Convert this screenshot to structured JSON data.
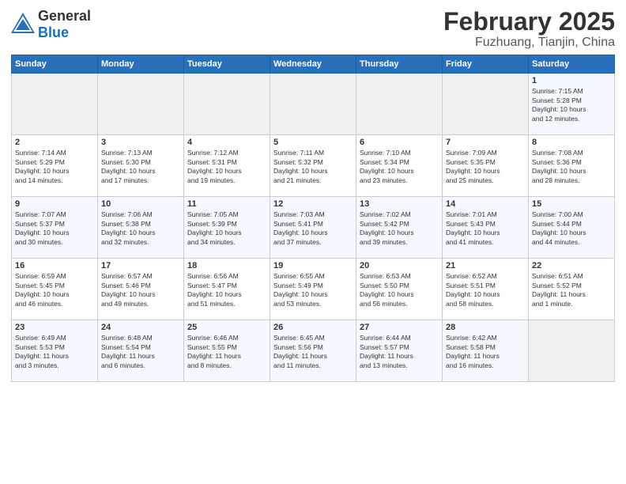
{
  "header": {
    "logo_general": "General",
    "logo_blue": "Blue",
    "month_title": "February 2025",
    "location": "Fuzhuang, Tianjin, China"
  },
  "days_of_week": [
    "Sunday",
    "Monday",
    "Tuesday",
    "Wednesday",
    "Thursday",
    "Friday",
    "Saturday"
  ],
  "weeks": [
    [
      {
        "day": "",
        "info": ""
      },
      {
        "day": "",
        "info": ""
      },
      {
        "day": "",
        "info": ""
      },
      {
        "day": "",
        "info": ""
      },
      {
        "day": "",
        "info": ""
      },
      {
        "day": "",
        "info": ""
      },
      {
        "day": "1",
        "info": "Sunrise: 7:15 AM\nSunset: 5:28 PM\nDaylight: 10 hours\nand 12 minutes."
      }
    ],
    [
      {
        "day": "2",
        "info": "Sunrise: 7:14 AM\nSunset: 5:29 PM\nDaylight: 10 hours\nand 14 minutes."
      },
      {
        "day": "3",
        "info": "Sunrise: 7:13 AM\nSunset: 5:30 PM\nDaylight: 10 hours\nand 17 minutes."
      },
      {
        "day": "4",
        "info": "Sunrise: 7:12 AM\nSunset: 5:31 PM\nDaylight: 10 hours\nand 19 minutes."
      },
      {
        "day": "5",
        "info": "Sunrise: 7:11 AM\nSunset: 5:32 PM\nDaylight: 10 hours\nand 21 minutes."
      },
      {
        "day": "6",
        "info": "Sunrise: 7:10 AM\nSunset: 5:34 PM\nDaylight: 10 hours\nand 23 minutes."
      },
      {
        "day": "7",
        "info": "Sunrise: 7:09 AM\nSunset: 5:35 PM\nDaylight: 10 hours\nand 25 minutes."
      },
      {
        "day": "8",
        "info": "Sunrise: 7:08 AM\nSunset: 5:36 PM\nDaylight: 10 hours\nand 28 minutes."
      }
    ],
    [
      {
        "day": "9",
        "info": "Sunrise: 7:07 AM\nSunset: 5:37 PM\nDaylight: 10 hours\nand 30 minutes."
      },
      {
        "day": "10",
        "info": "Sunrise: 7:06 AM\nSunset: 5:38 PM\nDaylight: 10 hours\nand 32 minutes."
      },
      {
        "day": "11",
        "info": "Sunrise: 7:05 AM\nSunset: 5:39 PM\nDaylight: 10 hours\nand 34 minutes."
      },
      {
        "day": "12",
        "info": "Sunrise: 7:03 AM\nSunset: 5:41 PM\nDaylight: 10 hours\nand 37 minutes."
      },
      {
        "day": "13",
        "info": "Sunrise: 7:02 AM\nSunset: 5:42 PM\nDaylight: 10 hours\nand 39 minutes."
      },
      {
        "day": "14",
        "info": "Sunrise: 7:01 AM\nSunset: 5:43 PM\nDaylight: 10 hours\nand 41 minutes."
      },
      {
        "day": "15",
        "info": "Sunrise: 7:00 AM\nSunset: 5:44 PM\nDaylight: 10 hours\nand 44 minutes."
      }
    ],
    [
      {
        "day": "16",
        "info": "Sunrise: 6:59 AM\nSunset: 5:45 PM\nDaylight: 10 hours\nand 46 minutes."
      },
      {
        "day": "17",
        "info": "Sunrise: 6:57 AM\nSunset: 5:46 PM\nDaylight: 10 hours\nand 49 minutes."
      },
      {
        "day": "18",
        "info": "Sunrise: 6:56 AM\nSunset: 5:47 PM\nDaylight: 10 hours\nand 51 minutes."
      },
      {
        "day": "19",
        "info": "Sunrise: 6:55 AM\nSunset: 5:49 PM\nDaylight: 10 hours\nand 53 minutes."
      },
      {
        "day": "20",
        "info": "Sunrise: 6:53 AM\nSunset: 5:50 PM\nDaylight: 10 hours\nand 56 minutes."
      },
      {
        "day": "21",
        "info": "Sunrise: 6:52 AM\nSunset: 5:51 PM\nDaylight: 10 hours\nand 58 minutes."
      },
      {
        "day": "22",
        "info": "Sunrise: 6:51 AM\nSunset: 5:52 PM\nDaylight: 11 hours\nand 1 minute."
      }
    ],
    [
      {
        "day": "23",
        "info": "Sunrise: 6:49 AM\nSunset: 5:53 PM\nDaylight: 11 hours\nand 3 minutes."
      },
      {
        "day": "24",
        "info": "Sunrise: 6:48 AM\nSunset: 5:54 PM\nDaylight: 11 hours\nand 6 minutes."
      },
      {
        "day": "25",
        "info": "Sunrise: 6:46 AM\nSunset: 5:55 PM\nDaylight: 11 hours\nand 8 minutes."
      },
      {
        "day": "26",
        "info": "Sunrise: 6:45 AM\nSunset: 5:56 PM\nDaylight: 11 hours\nand 11 minutes."
      },
      {
        "day": "27",
        "info": "Sunrise: 6:44 AM\nSunset: 5:57 PM\nDaylight: 11 hours\nand 13 minutes."
      },
      {
        "day": "28",
        "info": "Sunrise: 6:42 AM\nSunset: 5:58 PM\nDaylight: 11 hours\nand 16 minutes."
      },
      {
        "day": "",
        "info": ""
      }
    ]
  ]
}
